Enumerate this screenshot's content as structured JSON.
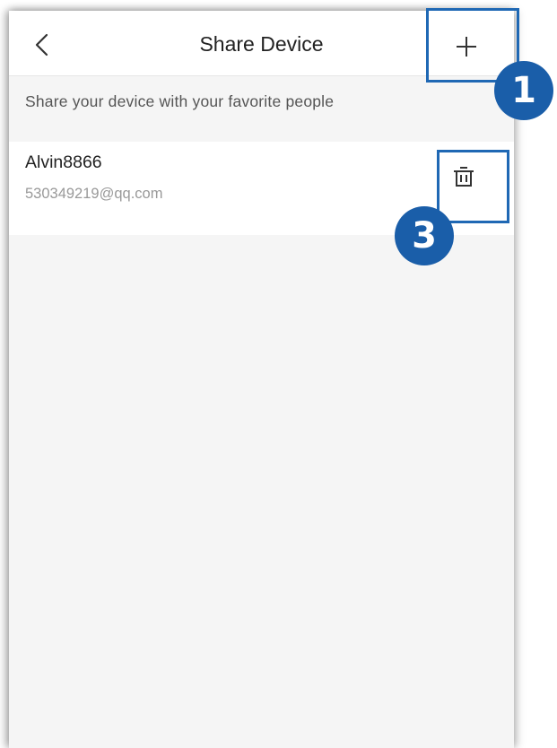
{
  "header": {
    "title": "Share Device",
    "back_icon": "chevron-left-icon",
    "add_icon": "plus-icon"
  },
  "subtitle": "Share your device with your favorite people",
  "shared_users": [
    {
      "name": "Alvin8866",
      "email": "530349219@qq.com",
      "delete_icon": "trash-icon"
    }
  ],
  "annotations": {
    "badge_add": "1",
    "badge_delete": "3",
    "accent_color": "#1a5ea9"
  }
}
